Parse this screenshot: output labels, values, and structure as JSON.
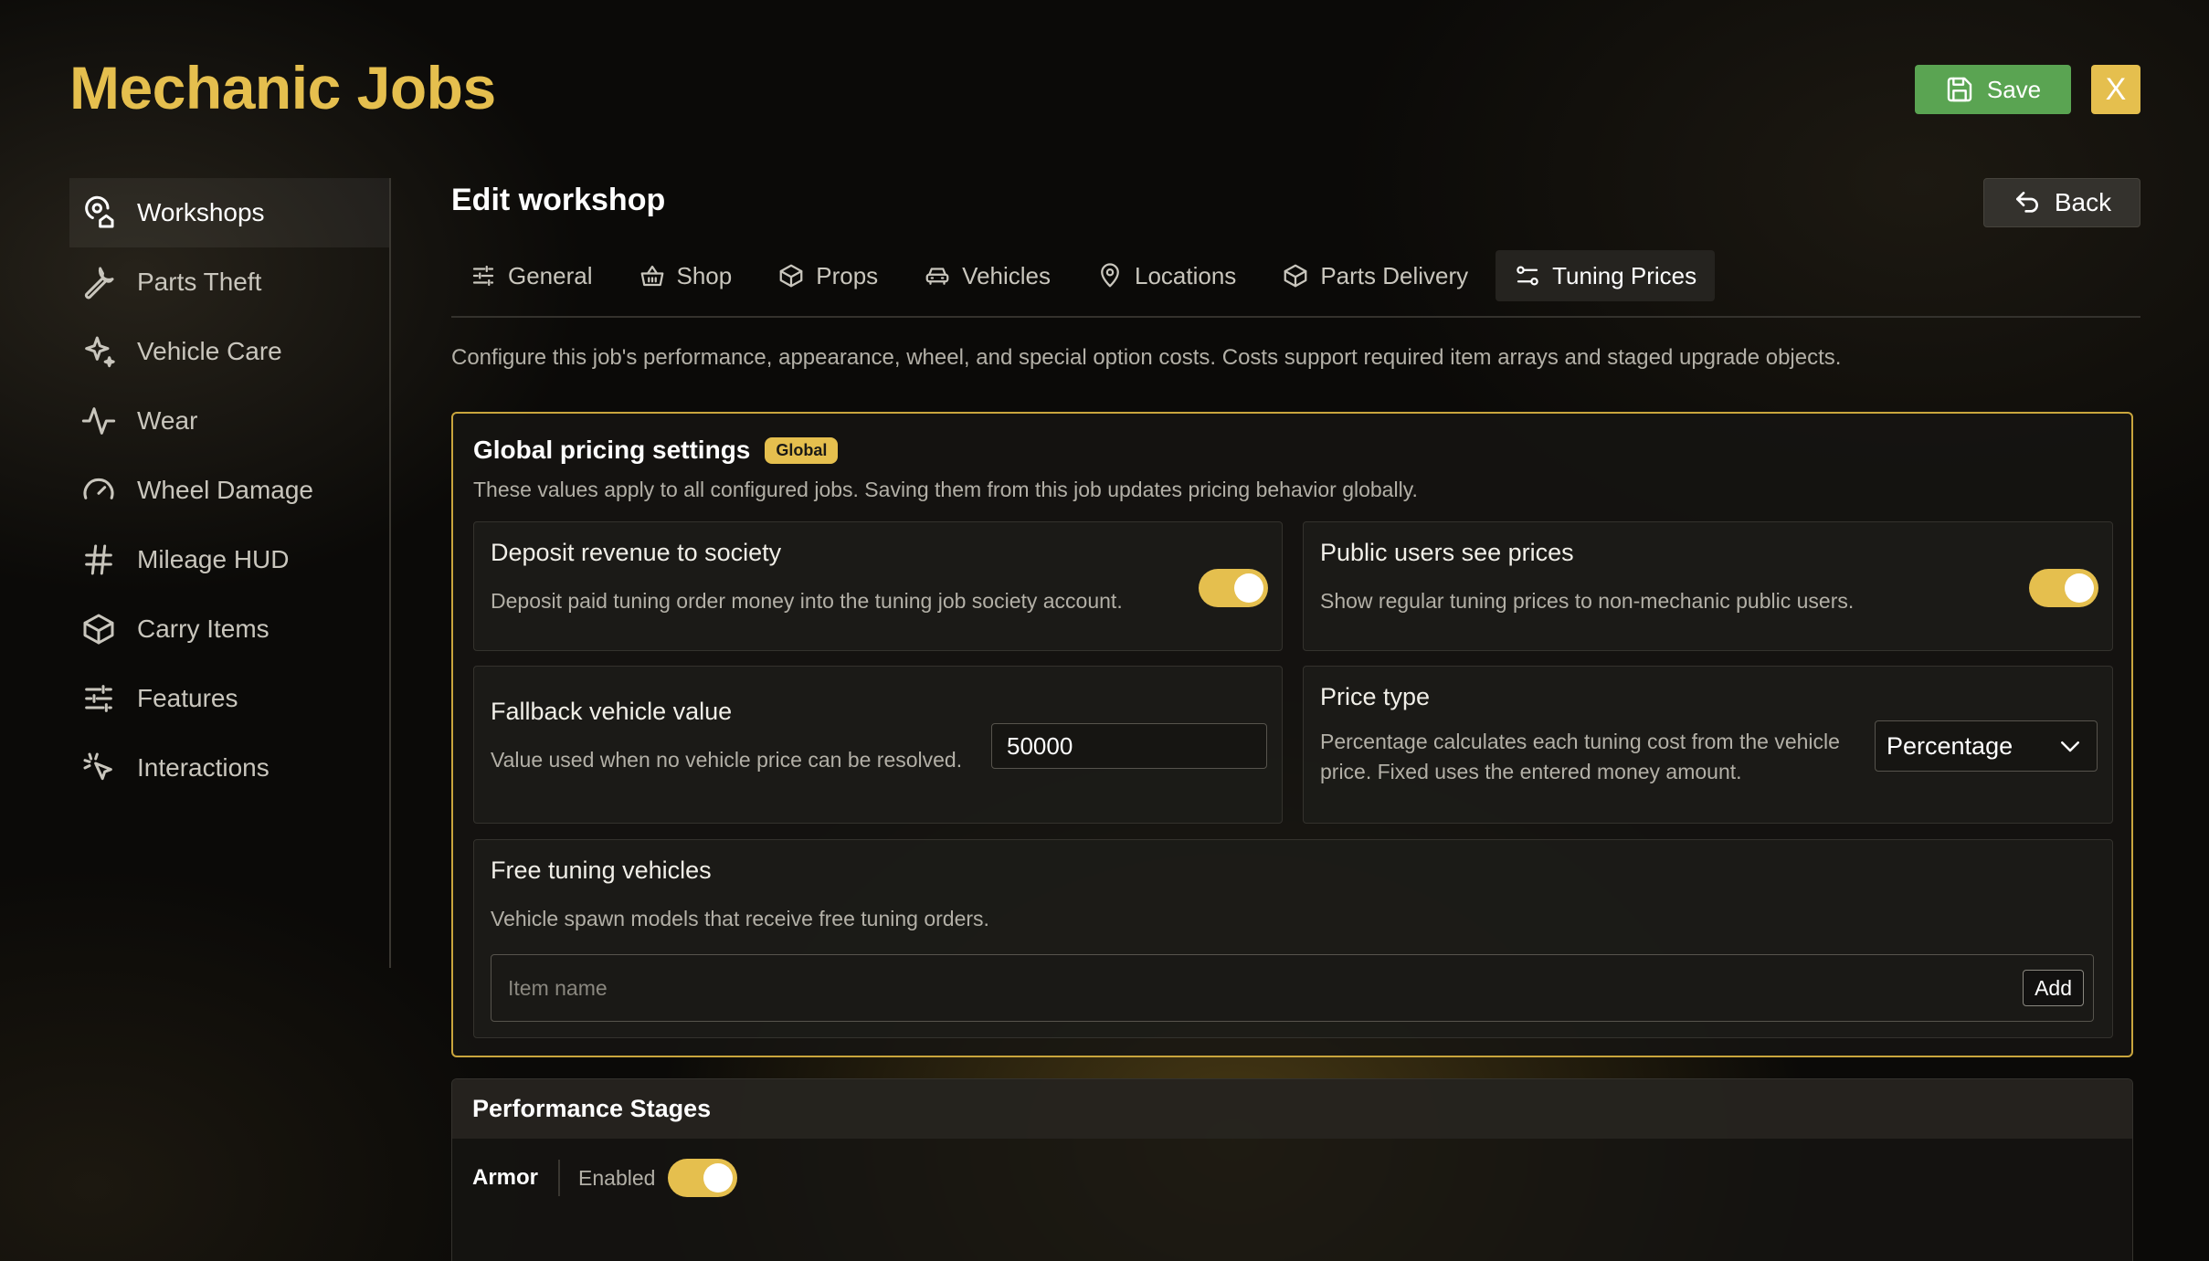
{
  "app": {
    "title": "Mechanic Jobs"
  },
  "header": {
    "save_label": "Save",
    "close_label": "X"
  },
  "sidebar": {
    "items": [
      {
        "label": "Workshops",
        "icon": "workshop-pin-icon",
        "active": true
      },
      {
        "label": "Parts Theft",
        "icon": "wrench-icon"
      },
      {
        "label": "Vehicle Care",
        "icon": "sparkles-icon"
      },
      {
        "label": "Wear",
        "icon": "activity-icon"
      },
      {
        "label": "Wheel Damage",
        "icon": "gauge-icon"
      },
      {
        "label": "Mileage HUD",
        "icon": "hash-icon"
      },
      {
        "label": "Carry Items",
        "icon": "box-icon"
      },
      {
        "label": "Features",
        "icon": "sliders-icon"
      },
      {
        "label": "Interactions",
        "icon": "pointer-click-icon"
      }
    ]
  },
  "main": {
    "title": "Edit workshop",
    "back_label": "Back",
    "tabs": [
      {
        "label": "General",
        "icon": "sliders-icon"
      },
      {
        "label": "Shop",
        "icon": "basket-icon"
      },
      {
        "label": "Props",
        "icon": "box-icon"
      },
      {
        "label": "Vehicles",
        "icon": "car-icon"
      },
      {
        "label": "Locations",
        "icon": "map-pin-icon"
      },
      {
        "label": "Parts Delivery",
        "icon": "box-icon"
      },
      {
        "label": "Tuning Prices",
        "icon": "settings-toggle-icon",
        "active": true
      }
    ],
    "description": "Configure this job's performance, appearance, wheel, and special option costs. Costs support required item arrays and staged upgrade objects."
  },
  "global": {
    "title": "Global pricing settings",
    "badge": "Global",
    "subtitle": "These values apply to all configured jobs. Saving them from this job updates pricing behavior globally.",
    "deposit": {
      "title": "Deposit revenue to society",
      "text": "Deposit paid tuning order money into the tuning job society account.",
      "enabled": true
    },
    "public": {
      "title": "Public users see prices",
      "text": "Show regular tuning prices to non-mechanic public users.",
      "enabled": true
    },
    "fallback": {
      "title": "Fallback vehicle value",
      "text": "Value used when no vehicle price can be resolved.",
      "value": "50000"
    },
    "price_type": {
      "title": "Price type",
      "text_line1": "Percentage calculates each tuning cost from the vehicle",
      "text_line2": "price. Fixed uses the entered money amount.",
      "selected": "Percentage"
    },
    "free": {
      "title": "Free tuning vehicles",
      "text": "Vehicle spawn models that receive free tuning orders.",
      "placeholder": "Item name",
      "add_label": "Add"
    }
  },
  "performance": {
    "title": "Performance Stages",
    "row": {
      "name": "Armor",
      "enabled_label": "Enabled",
      "enabled": true
    }
  },
  "colors": {
    "accent": "#e5bf4e",
    "save": "#5aa452",
    "background": "#0b0a08"
  }
}
